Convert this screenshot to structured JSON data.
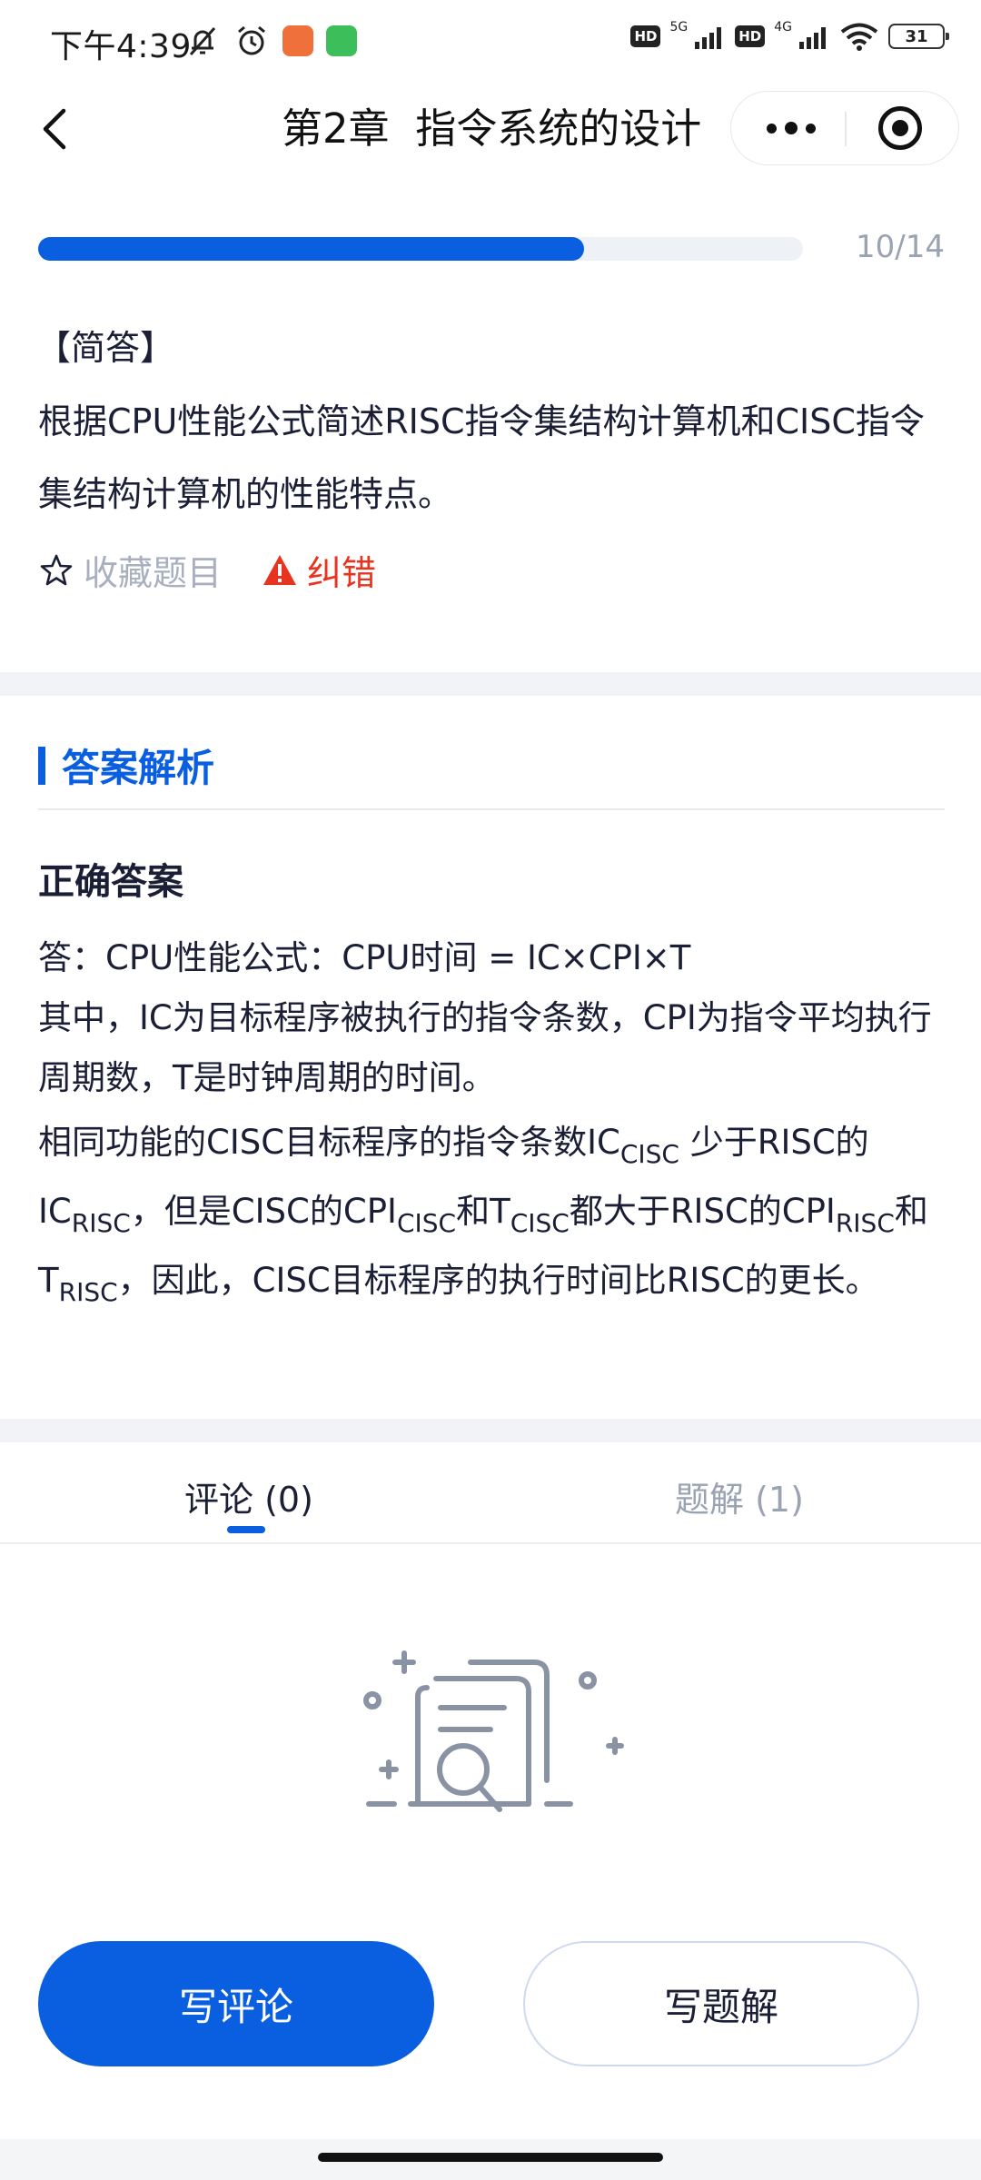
{
  "status_bar": {
    "time": "下午4:39",
    "network_1": "5G",
    "network_2": "4G",
    "hd_1": "HD",
    "hd_2": "HD",
    "battery": "31",
    "icons": [
      "mute-bell-icon",
      "alarm-icon",
      "app-notification-orange-icon",
      "app-notification-green-icon",
      "signal-icon",
      "wifi-icon",
      "battery-icon"
    ]
  },
  "nav": {
    "title": "第2章  指令系统的设计",
    "icons": [
      "back-icon",
      "more-icon",
      "close-miniprogram-icon"
    ]
  },
  "progress": {
    "text": "10/14",
    "fraction": 0.714
  },
  "question": {
    "type": "【简答】",
    "text": "根据CPU性能公式简述RISC指令集结构计算机和CISC指令集结构计算机的性能特点。",
    "favorite_label": "收藏题目",
    "report_label": "纠错"
  },
  "answer": {
    "section_title": "答案解析",
    "correct_title": "正确答案",
    "line1": "答：CPU性能公式：CPU时间 = IC×CPI×T",
    "line2": "其中，IC为目标程序被执行的指令条数，CPI为指令平均执行周期数，T是时钟周期的时间。",
    "line3": {
      "t1": "相同功能的CISC目标程序的指令条数IC",
      "s1": "CISC",
      "t2": " 少于RISC的IC",
      "s2": "RISC",
      "t3": "，但是CISC的CPI",
      "s3": "CISC",
      "t4": "和T",
      "s4": "CISC",
      "t5": "都大于RISC的CPI",
      "s5": "RISC",
      "t6": "和T",
      "s6": "RISC",
      "t7": "，因此，CISC目标程序的执行时间比RISC的更长。"
    }
  },
  "tabs": [
    {
      "label": "评论 (0)",
      "active": true
    },
    {
      "label": "题解 (1)",
      "active": false
    }
  ],
  "buttons": {
    "write_comment": "写评论",
    "write_solution": "写题解"
  },
  "colors": {
    "accent": "#0a5ee0",
    "report": "#e8331f",
    "muted": "#9aa3b2"
  }
}
